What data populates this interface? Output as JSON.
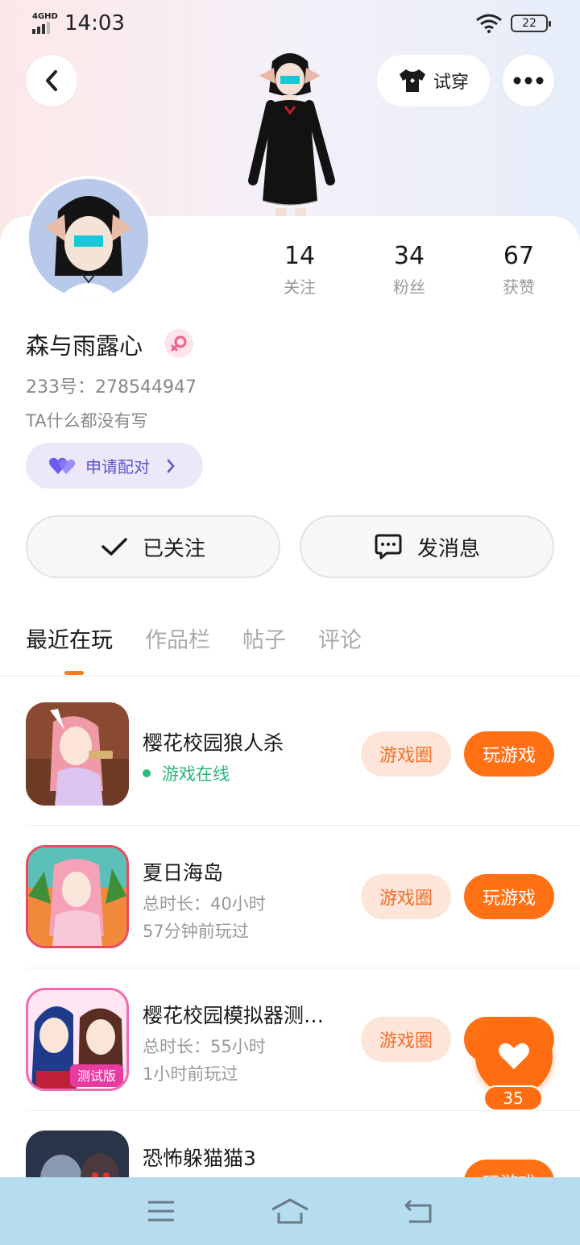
{
  "status_bar": {
    "network": "4GHD",
    "time": "14:03",
    "battery": "22"
  },
  "header": {
    "try_on_label": "试穿"
  },
  "profile": {
    "stats": [
      {
        "value": "14",
        "label": "关注"
      },
      {
        "value": "34",
        "label": "粉丝"
      },
      {
        "value": "67",
        "label": "获赞"
      }
    ],
    "nickname": "森与雨露心",
    "uid": "233号：278544947",
    "bio": "TA什么都没有写",
    "pair_label": "申请配对"
  },
  "actions": {
    "follow_label": "已关注",
    "message_label": "发消息"
  },
  "tabs": [
    {
      "label": "最近在玩",
      "active": true
    },
    {
      "label": "作品栏",
      "active": false
    },
    {
      "label": "帖子",
      "active": false
    },
    {
      "label": "评论",
      "active": false
    }
  ],
  "games": [
    {
      "title": "樱花校园狼人杀",
      "status": "游戏在线",
      "circle_label": "游戏圈",
      "play_label": "玩游戏"
    },
    {
      "title": "夏日海岛",
      "duration": "总时长：40小时",
      "last_played": "57分钟前玩过",
      "circle_label": "游戏圈",
      "play_label": "玩游戏"
    },
    {
      "title": "樱花校园模拟器测…",
      "duration": "总时长：55小时",
      "last_played": "1小时前玩过",
      "circle_label": "游戏圈",
      "play_label": "玩游戏"
    },
    {
      "title": "恐怖躲猫猫3",
      "play_label": "玩游戏"
    }
  ],
  "game_icon_badge": "测试版",
  "like_fab": {
    "count": "35"
  },
  "colors": {
    "accent_orange": "#ff7114",
    "online_green": "#27b77a",
    "pair_purple": "#5b55c9"
  }
}
